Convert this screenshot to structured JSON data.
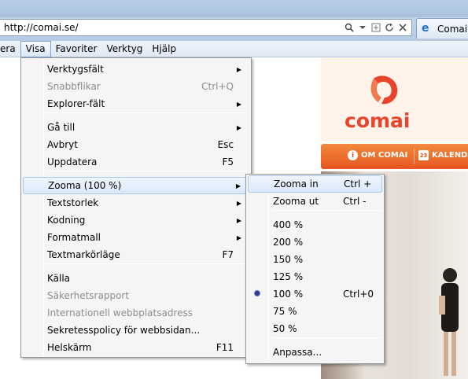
{
  "browser": {
    "address": "http://comai.se/",
    "tab_title": "Comai"
  },
  "menubar": {
    "items": [
      "era",
      "Visa",
      "Favoriter",
      "Verktyg",
      "Hjälp"
    ]
  },
  "visa_menu": {
    "items": [
      {
        "label": "Verktygsfält",
        "shortcut": "",
        "submenu": true,
        "disabled": false
      },
      {
        "label": "Snabbflikar",
        "shortcut": "Ctrl+Q",
        "submenu": false,
        "disabled": true
      },
      {
        "label": "Explorer-fält",
        "shortcut": "",
        "submenu": true,
        "disabled": false
      },
      {
        "label": "Gå till",
        "shortcut": "",
        "submenu": true,
        "disabled": false
      },
      {
        "label": "Avbryt",
        "shortcut": "Esc",
        "submenu": false,
        "disabled": false
      },
      {
        "label": "Uppdatera",
        "shortcut": "F5",
        "submenu": false,
        "disabled": false
      },
      {
        "label": "Zooma (100 %)",
        "shortcut": "",
        "submenu": true,
        "disabled": false,
        "highlighted": true
      },
      {
        "label": "Textstorlek",
        "shortcut": "",
        "submenu": true,
        "disabled": false
      },
      {
        "label": "Kodning",
        "shortcut": "",
        "submenu": true,
        "disabled": false
      },
      {
        "label": "Formatmall",
        "shortcut": "",
        "submenu": true,
        "disabled": false
      },
      {
        "label": "Textmarkörläge",
        "shortcut": "F7",
        "submenu": false,
        "disabled": false
      },
      {
        "label": "Källa",
        "shortcut": "",
        "submenu": false,
        "disabled": false
      },
      {
        "label": "Säkerhetsrapport",
        "shortcut": "",
        "submenu": false,
        "disabled": true
      },
      {
        "label": "Internationell webbplatsadress",
        "shortcut": "",
        "submenu": false,
        "disabled": true
      },
      {
        "label": "Sekretesspolicy för webbsidan...",
        "shortcut": "",
        "submenu": false,
        "disabled": false
      },
      {
        "label": "Helskärm",
        "shortcut": "F11",
        "submenu": false,
        "disabled": false
      }
    ]
  },
  "zoom_menu": {
    "items": [
      {
        "label": "Zooma in",
        "shortcut": "Ctrl +",
        "highlighted": true
      },
      {
        "label": "Zooma ut",
        "shortcut": "Ctrl -"
      },
      {
        "label": "400 %",
        "shortcut": ""
      },
      {
        "label": "200 %",
        "shortcut": ""
      },
      {
        "label": "150 %",
        "shortcut": ""
      },
      {
        "label": "125 %",
        "shortcut": ""
      },
      {
        "label": "100 %",
        "shortcut": "Ctrl+0",
        "selected": true
      },
      {
        "label": "75 %",
        "shortcut": ""
      },
      {
        "label": "50 %",
        "shortcut": ""
      },
      {
        "label": "Anpassa...",
        "shortcut": ""
      }
    ]
  },
  "site": {
    "logo_text": "comai",
    "nav_items": [
      "OM COMAI",
      "KALENDA"
    ],
    "nav_icon_labels": [
      "i",
      "23"
    ]
  },
  "colors": {
    "brand": "#e8452c",
    "nav": "#e6551f",
    "highlight_border": "#a8c8ec"
  }
}
